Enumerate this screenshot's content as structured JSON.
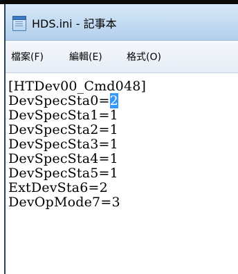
{
  "window": {
    "title": "HDS.ini - 記事本"
  },
  "menu": {
    "items": [
      {
        "label": "檔案(F)"
      },
      {
        "label": "編輯(E)"
      },
      {
        "label": "格式(O)"
      }
    ]
  },
  "editor": {
    "lines": [
      "[HTDev00_Cmd048]",
      "DevSpecSta0=",
      "DevSpecSta1=1",
      "DevSpecSta2=1",
      "DevSpecSta3=1",
      "DevSpecSta4=1",
      "DevSpecSta5=1",
      "ExtDevSta6=2",
      "DevOpMode7=3"
    ],
    "selected_text": "2",
    "selection_color": "#3399ff"
  }
}
